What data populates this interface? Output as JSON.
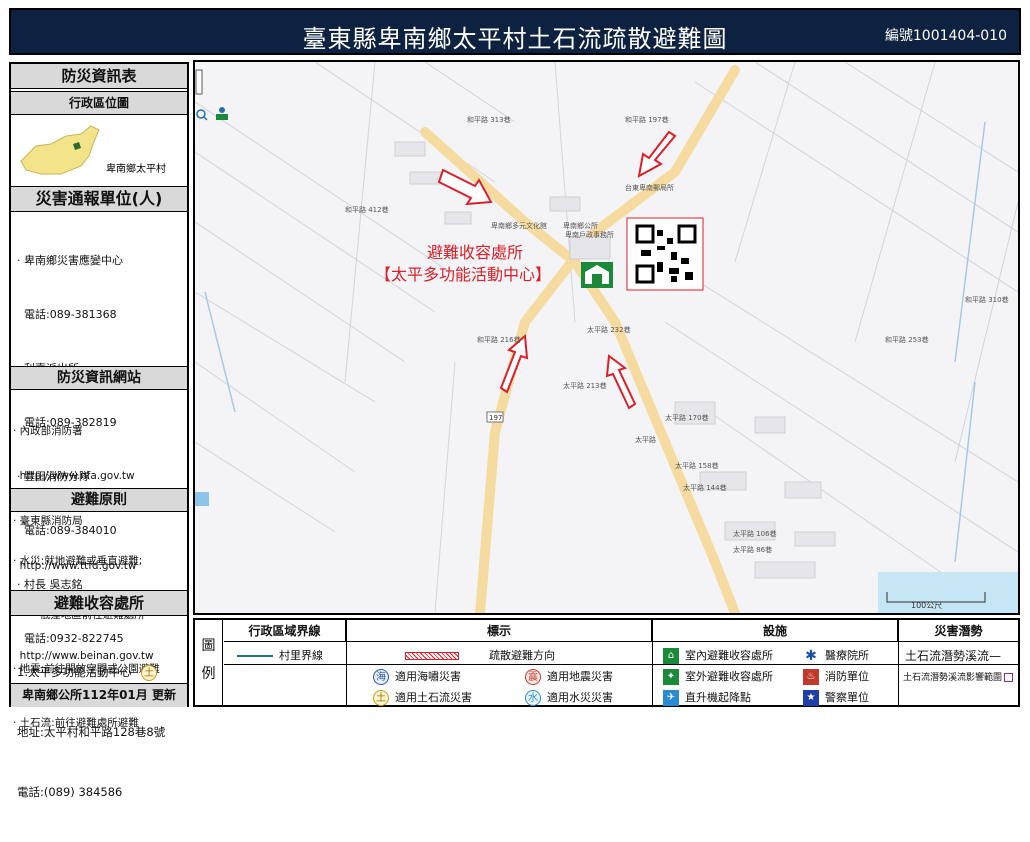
{
  "title": "臺東縣卑南鄉太平村土石流疏散避難圖",
  "code": "編號1001404-010",
  "sidebar": {
    "info_header": "防災資訊表",
    "admin_header": "行政區位圖",
    "locator_label": "卑南鄉太平村",
    "report_header": "災害通報單位(人)",
    "report_lines": [
      "‧ 卑南鄉災害應變中心",
      "  電話:089-381368",
      "‧ 利嘉派出所",
      "  電話:089-382819",
      "‧ 豐田消防分隊",
      "  電話:089-384010",
      "‧ 村長 吳志銘",
      "  電話:0932-822745"
    ],
    "web_header": "防災資訊網站",
    "web_lines": [
      "‧ 內政部消防署",
      "  http://www.nfa.gov.tw",
      "‧ 臺東縣消防局",
      "  http://www.ttfd.gov.tw",
      "‧ 卑南鄉公所",
      "  http://www.beinan.gov.tw"
    ],
    "principle_header": "避難原則",
    "principle_lines": [
      "‧ 水災:就地避難或垂直避難;",
      "        低窪地區前往避難處所",
      "‧ 地震:前往開放空間或公園避難",
      "‧ 土石流:前往避難處所避難"
    ],
    "shelter_header": "避難收容處所",
    "shelter_name": "1.太平多功能活動中心",
    "shelter_addr": "地址:太平村和平路128巷8號",
    "shelter_tel": "電話:(089) 384586",
    "updated": "卑南鄉公所112年01月 更新"
  },
  "map": {
    "shelter_title": "避難收容處所",
    "shelter_name": "【太平多功能活動中心】",
    "scale_label": "100公尺",
    "road_labels": [
      "太平路 213巷",
      "太平路",
      "太平路 170巷",
      "太平路 158巷",
      "太平路 144巷",
      "太平路 106巷",
      "太平路 86巷",
      "太平路 232巷",
      "和平路 197巷",
      "和平路 253巷",
      "和平路 310巷",
      "和平路 216巷",
      "和平路 412巷",
      "和平路 313巷",
      "台東卑南郵局所",
      "卑南鄉多元文化館",
      "卑南鄉公所",
      "卑南戶政事務所",
      "197"
    ],
    "route_label": "197"
  },
  "legend": {
    "side_label": "圖\n例",
    "h_boundary": "行政區域界線",
    "h_sign": "標示",
    "h_facility": "設施",
    "h_hazard": "災害潛勢",
    "village_boundary": "村里界線",
    "evac_direction": "疏散避難方向",
    "tsunami": "適用海嘯災害",
    "earthquake": "適用地震災害",
    "debris": "適用土石流災害",
    "flood": "適用水災災害",
    "indoor_shelter": "室內避難收容處所",
    "outdoor_shelter": "室外避難收容處所",
    "helipad": "直升機起降點",
    "hospital": "醫療院所",
    "fire": "消防單位",
    "police": "警察單位",
    "debris_stream": "土石流潛勢溪流—",
    "debris_area": "土石流潛勢溪流影響範圍",
    "icon_sea": "海",
    "icon_quake": "震",
    "icon_soil": "土",
    "icon_water": "水"
  },
  "colors": {
    "title_bg": "#0d2140",
    "arrow": "#d9202a",
    "road": "#f6dba0",
    "shelter_icon": "#1a8a3a"
  }
}
